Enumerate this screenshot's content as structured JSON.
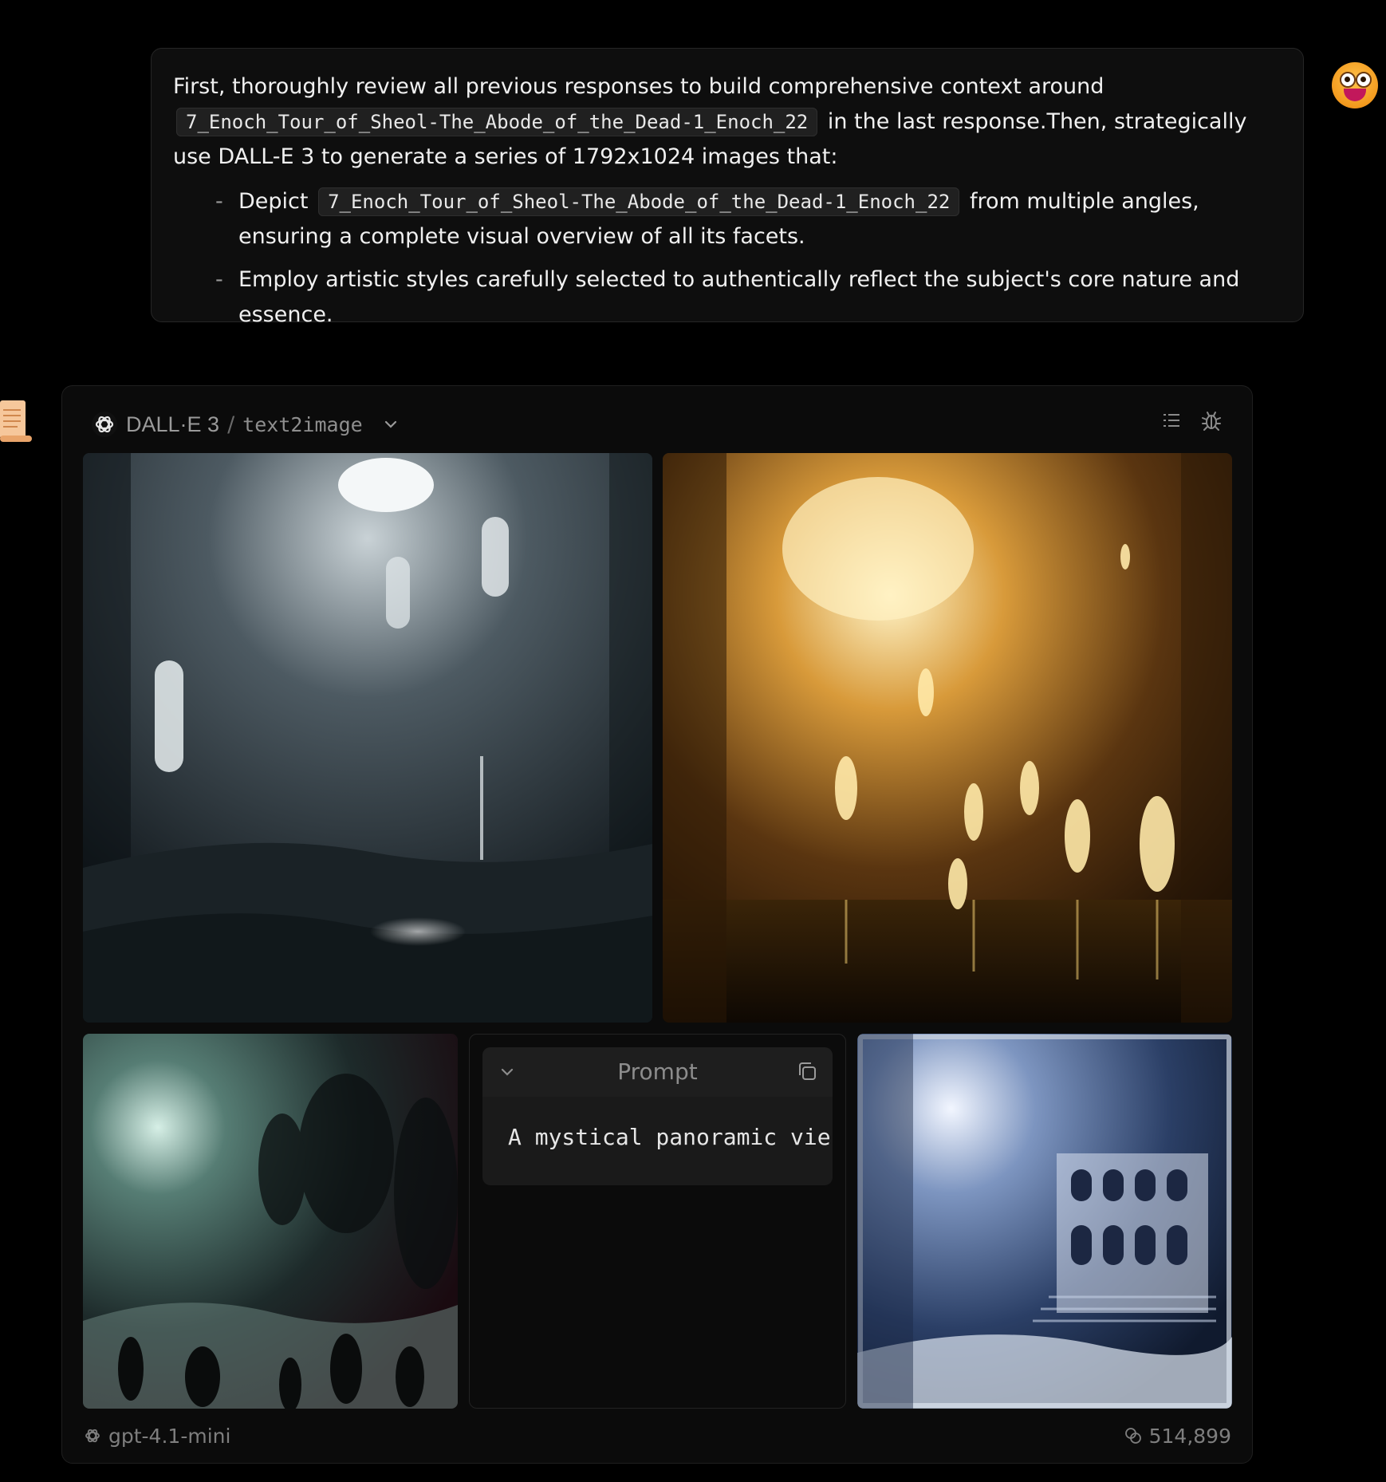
{
  "user_message": {
    "intro_before": "First, thoroughly review all previous responses to build comprehensive context around",
    "code_1": "7_Enoch_Tour_of_Sheol-The_Abode_of_the_Dead-1_Enoch_22",
    "intro_after": "in the last response.Then, strategically use DALL-E 3 to generate a series of 1792x1024 images that:",
    "bullet_1_before": "Depict",
    "bullet_1_code": "7_Enoch_Tour_of_Sheol-The_Abode_of_the_Dead-1_Enoch_22",
    "bullet_1_after": "from multiple angles, ensuring a complete visual overview of all its facets.",
    "bullet_2": "Employ artistic styles carefully selected to authentically reflect the subject's core nature and essence.",
    "bullet_marker": "-"
  },
  "plugin_card": {
    "plugin_name": "DALL·E 3",
    "separator": "/",
    "api_name": "text2image",
    "icons": {
      "logo": "openai-logo-icon",
      "dropdown": "chevron-down-icon",
      "list": "list-icon",
      "debug": "bug-icon"
    },
    "prompt": {
      "label": "Prompt",
      "text": "A mystical panoramic vie"
    },
    "footer": {
      "model": "gpt-4.1-mini",
      "tokens": "514,899"
    }
  },
  "colors": {
    "background": "#000000",
    "bubble": "#0e0e0e",
    "card": "#0b0b0b",
    "muted_text": "#8e8e8e"
  }
}
